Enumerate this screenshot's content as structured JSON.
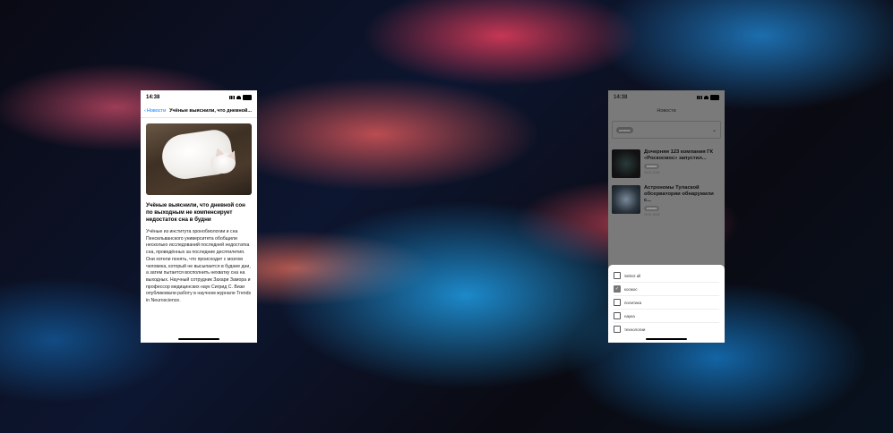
{
  "left_phone": {
    "time": "14:38",
    "nav": {
      "back_label": "Новости",
      "title": "Учёные выяснили, что дневной..."
    },
    "article_title": "Учёные выяснили, что дневной сон по выходным не компенсирует недостаток сна в будни",
    "article_body": "Учёные из института хронобиологии и сна Пенсильванского университета обобщили несколько исследований последней недостатка сна, проведённых за последние десятилетия. Они хотели понять, что происходит с мозгом человека, который не высыпается в будние дни, а затем пытается восполнить нехватку сна на выходных. Научный сотрудник Захари Замора и профессор медицинских наук Сигрид С. Визи опубликовали работу в научном журнале Trends in Neuroscience."
  },
  "right_phone": {
    "time": "14:38",
    "title": "Новости",
    "filter_chip": "космос",
    "news": [
      {
        "title": "Дочерняя 123 компания ГК «Роскосмос» запустил...",
        "tag": "космос",
        "date": "19.01.2024"
      },
      {
        "title": "Астрономы Тулаской обсерватории обнаружили с...",
        "tag": "космос",
        "date": "19.01.2024"
      }
    ],
    "options": [
      {
        "label": "Select all",
        "checked": false
      },
      {
        "label": "космос",
        "checked": true
      },
      {
        "label": "политика",
        "checked": false
      },
      {
        "label": "наука",
        "checked": false
      },
      {
        "label": "технологии",
        "checked": false
      }
    ]
  }
}
